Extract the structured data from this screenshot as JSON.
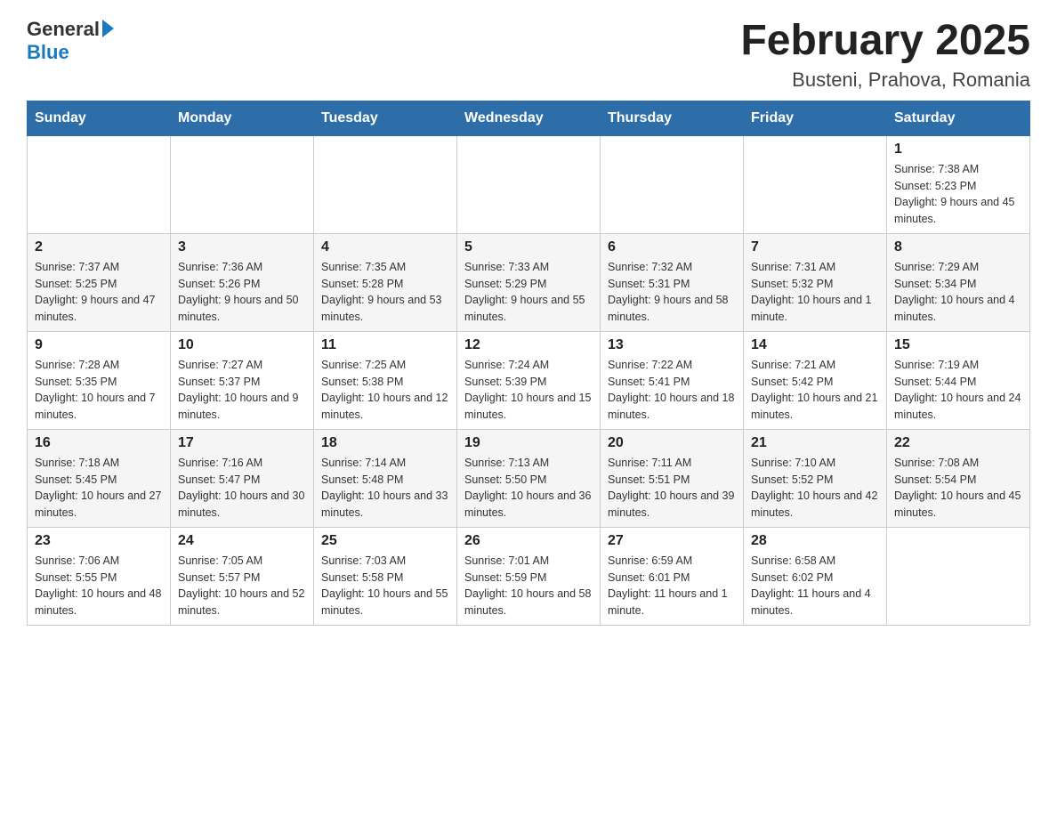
{
  "logo": {
    "general": "General",
    "blue": "Blue"
  },
  "title": {
    "month_year": "February 2025",
    "location": "Busteni, Prahova, Romania"
  },
  "days_of_week": [
    "Sunday",
    "Monday",
    "Tuesday",
    "Wednesday",
    "Thursday",
    "Friday",
    "Saturday"
  ],
  "weeks": [
    [
      {
        "day": "",
        "info": ""
      },
      {
        "day": "",
        "info": ""
      },
      {
        "day": "",
        "info": ""
      },
      {
        "day": "",
        "info": ""
      },
      {
        "day": "",
        "info": ""
      },
      {
        "day": "",
        "info": ""
      },
      {
        "day": "1",
        "info": "Sunrise: 7:38 AM\nSunset: 5:23 PM\nDaylight: 9 hours and 45 minutes."
      }
    ],
    [
      {
        "day": "2",
        "info": "Sunrise: 7:37 AM\nSunset: 5:25 PM\nDaylight: 9 hours and 47 minutes."
      },
      {
        "day": "3",
        "info": "Sunrise: 7:36 AM\nSunset: 5:26 PM\nDaylight: 9 hours and 50 minutes."
      },
      {
        "day": "4",
        "info": "Sunrise: 7:35 AM\nSunset: 5:28 PM\nDaylight: 9 hours and 53 minutes."
      },
      {
        "day": "5",
        "info": "Sunrise: 7:33 AM\nSunset: 5:29 PM\nDaylight: 9 hours and 55 minutes."
      },
      {
        "day": "6",
        "info": "Sunrise: 7:32 AM\nSunset: 5:31 PM\nDaylight: 9 hours and 58 minutes."
      },
      {
        "day": "7",
        "info": "Sunrise: 7:31 AM\nSunset: 5:32 PM\nDaylight: 10 hours and 1 minute."
      },
      {
        "day": "8",
        "info": "Sunrise: 7:29 AM\nSunset: 5:34 PM\nDaylight: 10 hours and 4 minutes."
      }
    ],
    [
      {
        "day": "9",
        "info": "Sunrise: 7:28 AM\nSunset: 5:35 PM\nDaylight: 10 hours and 7 minutes."
      },
      {
        "day": "10",
        "info": "Sunrise: 7:27 AM\nSunset: 5:37 PM\nDaylight: 10 hours and 9 minutes."
      },
      {
        "day": "11",
        "info": "Sunrise: 7:25 AM\nSunset: 5:38 PM\nDaylight: 10 hours and 12 minutes."
      },
      {
        "day": "12",
        "info": "Sunrise: 7:24 AM\nSunset: 5:39 PM\nDaylight: 10 hours and 15 minutes."
      },
      {
        "day": "13",
        "info": "Sunrise: 7:22 AM\nSunset: 5:41 PM\nDaylight: 10 hours and 18 minutes."
      },
      {
        "day": "14",
        "info": "Sunrise: 7:21 AM\nSunset: 5:42 PM\nDaylight: 10 hours and 21 minutes."
      },
      {
        "day": "15",
        "info": "Sunrise: 7:19 AM\nSunset: 5:44 PM\nDaylight: 10 hours and 24 minutes."
      }
    ],
    [
      {
        "day": "16",
        "info": "Sunrise: 7:18 AM\nSunset: 5:45 PM\nDaylight: 10 hours and 27 minutes."
      },
      {
        "day": "17",
        "info": "Sunrise: 7:16 AM\nSunset: 5:47 PM\nDaylight: 10 hours and 30 minutes."
      },
      {
        "day": "18",
        "info": "Sunrise: 7:14 AM\nSunset: 5:48 PM\nDaylight: 10 hours and 33 minutes."
      },
      {
        "day": "19",
        "info": "Sunrise: 7:13 AM\nSunset: 5:50 PM\nDaylight: 10 hours and 36 minutes."
      },
      {
        "day": "20",
        "info": "Sunrise: 7:11 AM\nSunset: 5:51 PM\nDaylight: 10 hours and 39 minutes."
      },
      {
        "day": "21",
        "info": "Sunrise: 7:10 AM\nSunset: 5:52 PM\nDaylight: 10 hours and 42 minutes."
      },
      {
        "day": "22",
        "info": "Sunrise: 7:08 AM\nSunset: 5:54 PM\nDaylight: 10 hours and 45 minutes."
      }
    ],
    [
      {
        "day": "23",
        "info": "Sunrise: 7:06 AM\nSunset: 5:55 PM\nDaylight: 10 hours and 48 minutes."
      },
      {
        "day": "24",
        "info": "Sunrise: 7:05 AM\nSunset: 5:57 PM\nDaylight: 10 hours and 52 minutes."
      },
      {
        "day": "25",
        "info": "Sunrise: 7:03 AM\nSunset: 5:58 PM\nDaylight: 10 hours and 55 minutes."
      },
      {
        "day": "26",
        "info": "Sunrise: 7:01 AM\nSunset: 5:59 PM\nDaylight: 10 hours and 58 minutes."
      },
      {
        "day": "27",
        "info": "Sunrise: 6:59 AM\nSunset: 6:01 PM\nDaylight: 11 hours and 1 minute."
      },
      {
        "day": "28",
        "info": "Sunrise: 6:58 AM\nSunset: 6:02 PM\nDaylight: 11 hours and 4 minutes."
      },
      {
        "day": "",
        "info": ""
      }
    ]
  ]
}
